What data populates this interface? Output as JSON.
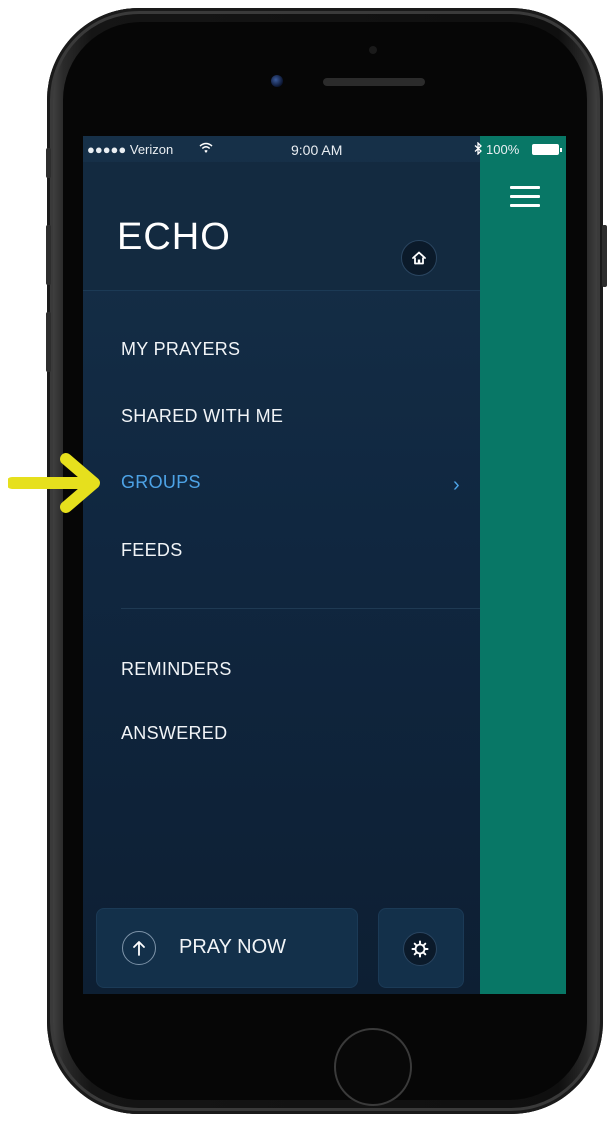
{
  "status_bar": {
    "carrier": "●●●●● Verizon",
    "time": "9:00 AM",
    "battery_percent": "100%"
  },
  "header": {
    "logo": "ECHO",
    "home_icon": "home-icon"
  },
  "menu": {
    "items": [
      {
        "label": "MY PRAYERS",
        "active": false
      },
      {
        "label": "SHARED WITH ME",
        "active": false
      },
      {
        "label": "GROUPS",
        "active": true
      },
      {
        "label": "FEEDS",
        "active": false
      },
      {
        "label": "REMINDERS",
        "active": false
      },
      {
        "label": "ANSWERED",
        "active": false
      }
    ],
    "active_chevron": "›"
  },
  "footer": {
    "pray_now_label": "PRAY NOW",
    "pray_icon": "arrow-up-icon",
    "settings_icon": "gear-icon"
  },
  "colors": {
    "menu_bg": "#102740",
    "accent_teal": "#087766",
    "active_item": "#4da3e6",
    "annotation_arrow": "#e6e01d"
  }
}
